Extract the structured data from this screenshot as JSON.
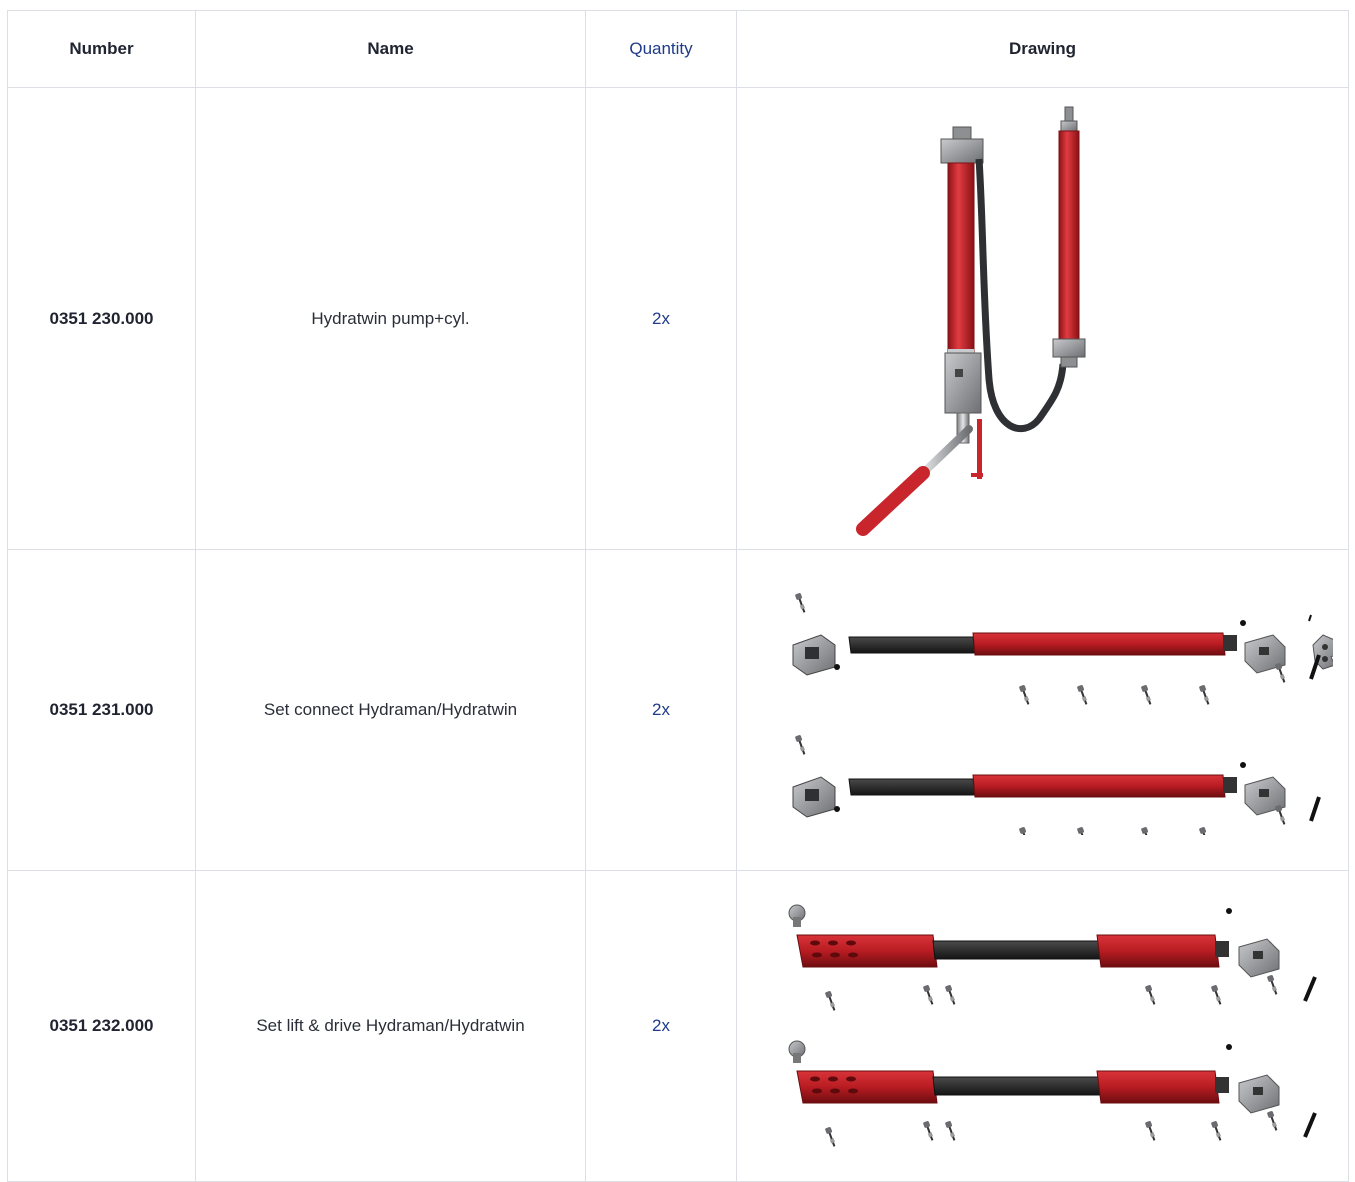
{
  "table": {
    "headers": {
      "number": "Number",
      "name": "Name",
      "quantity": "Quantity",
      "drawing": "Drawing"
    },
    "rows": [
      {
        "number": "0351 230.000",
        "name": "Hydratwin pump+cyl.",
        "quantity": "2x",
        "drawing": "hydraulic-pump-cylinder-drawing"
      },
      {
        "number": "0351 231.000",
        "name": "Set connect Hydraman/Hydratwin",
        "quantity": "2x",
        "drawing": "connect-set-exploded-drawing"
      },
      {
        "number": "0351 232.000",
        "name": "Set lift & drive Hydraman/Hydratwin",
        "quantity": "2x",
        "drawing": "lift-drive-set-exploded-drawing"
      }
    ]
  },
  "colors": {
    "header_text": "#1f2430",
    "quantity_text": "#1f3b8a",
    "border": "#dcdfe6",
    "part_red": "#b81c22",
    "part_dark": "#2a2a2a",
    "part_grey": "#8d8f93"
  }
}
